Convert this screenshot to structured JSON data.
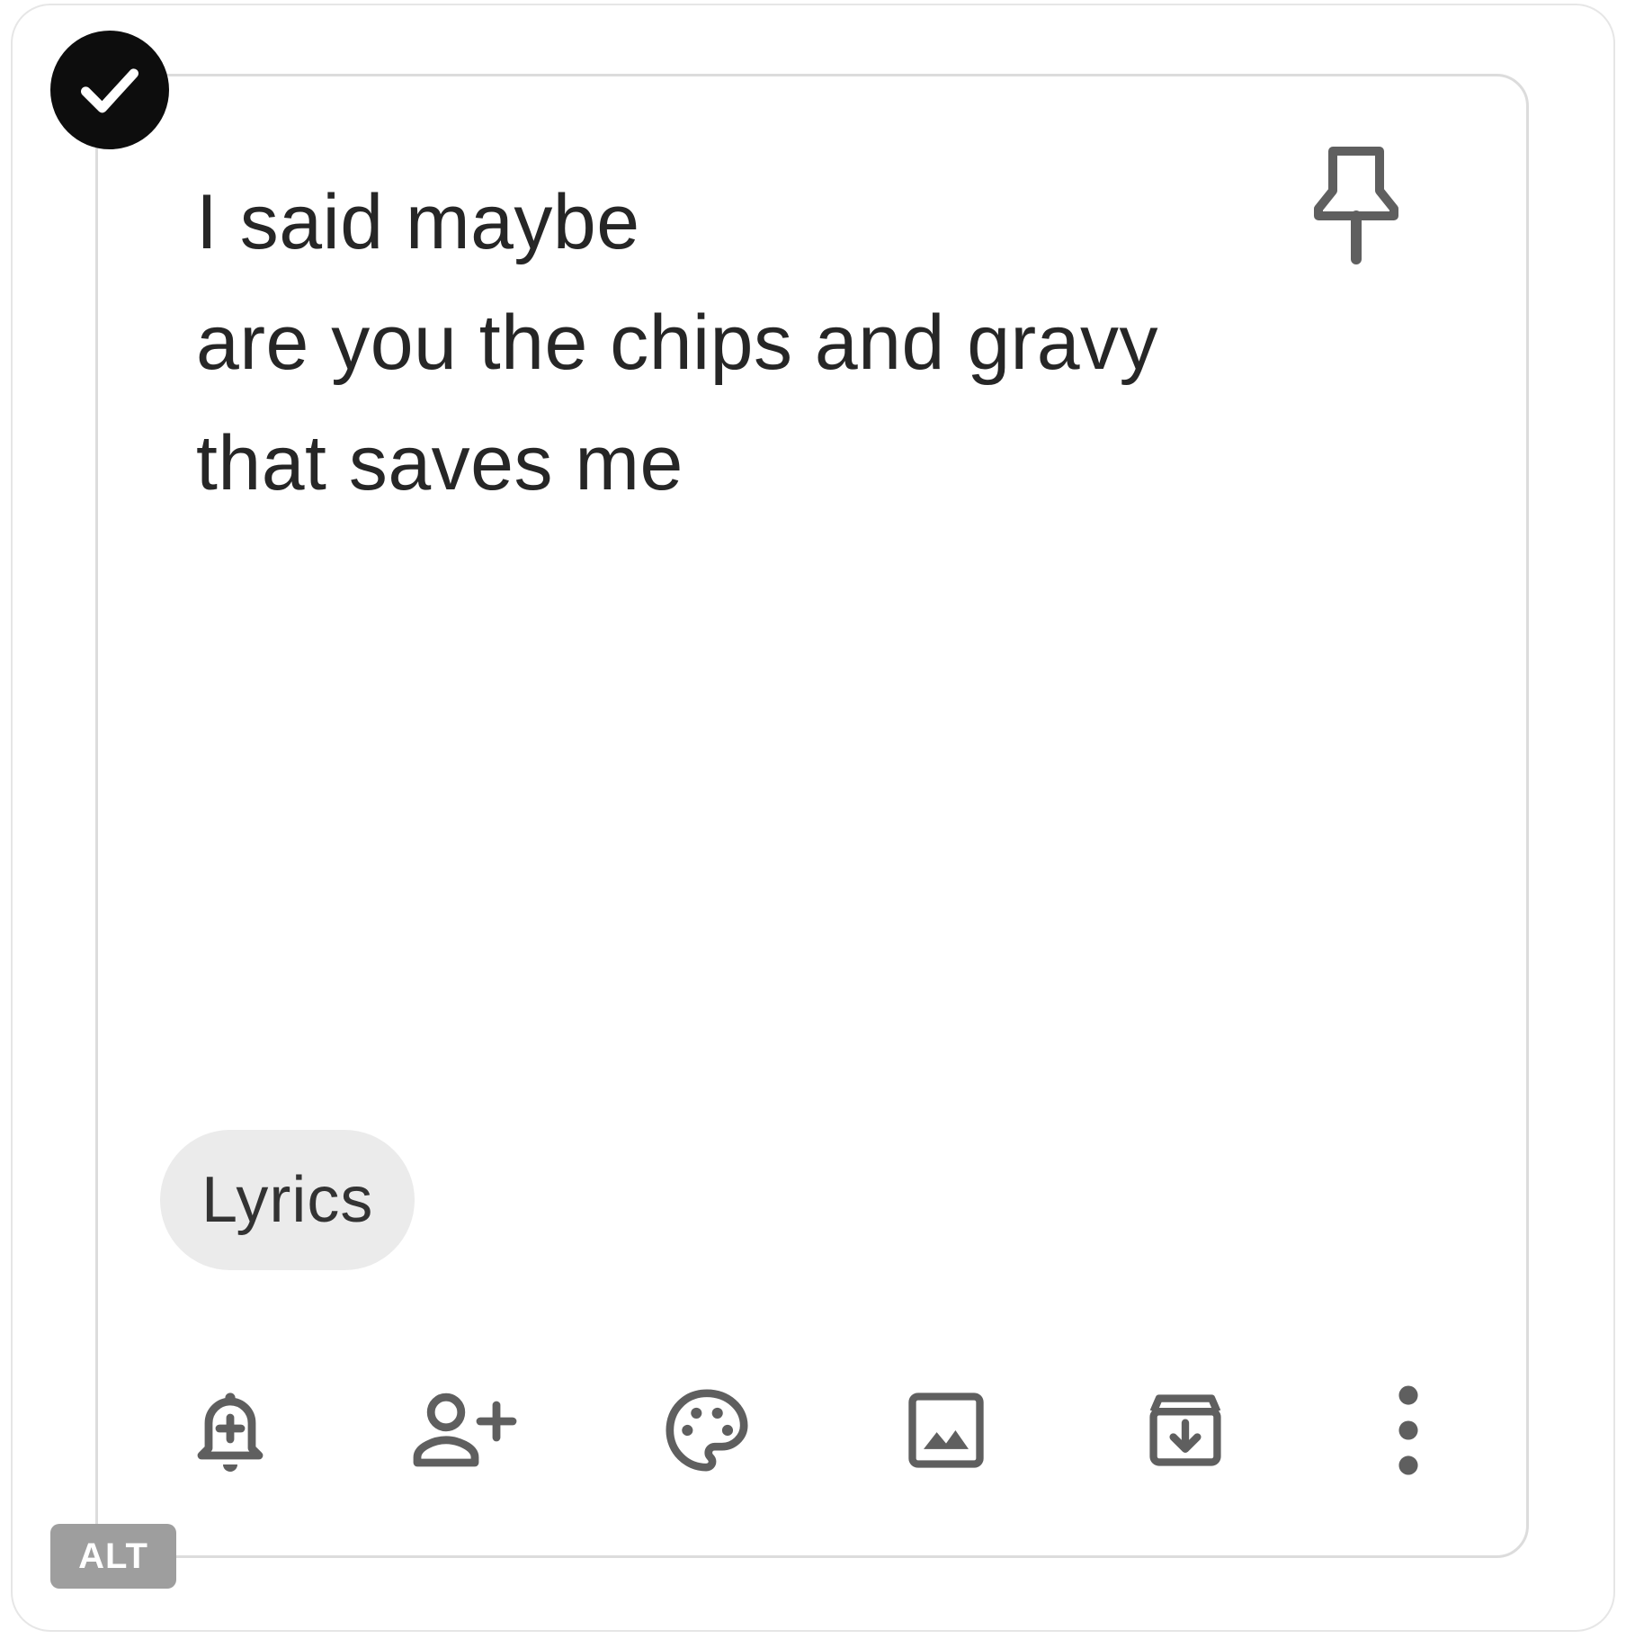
{
  "note": {
    "lines": [
      "I said maybe",
      "are you the chips and gravy",
      "that saves me"
    ],
    "selected": true,
    "pinned": false,
    "label": "Lyrics"
  },
  "icons": {
    "select": "check-circle-icon",
    "pin": "pin-icon"
  },
  "toolbar": [
    {
      "name": "remind-me",
      "icon": "bell-plus-icon"
    },
    {
      "name": "collaborator",
      "icon": "person-add-icon"
    },
    {
      "name": "background-options",
      "icon": "palette-icon"
    },
    {
      "name": "add-image",
      "icon": "image-icon"
    },
    {
      "name": "archive",
      "icon": "archive-icon"
    },
    {
      "name": "more",
      "icon": "more-vertical-icon"
    }
  ],
  "badge": {
    "text": "ALT"
  },
  "colors": {
    "text": "#262626",
    "icon": "#5f5f5f",
    "chip_bg": "#ebebeb",
    "check_bg": "#0d0d0d",
    "badge_bg": "#9e9e9e",
    "card_border": "#dcdcdc"
  }
}
